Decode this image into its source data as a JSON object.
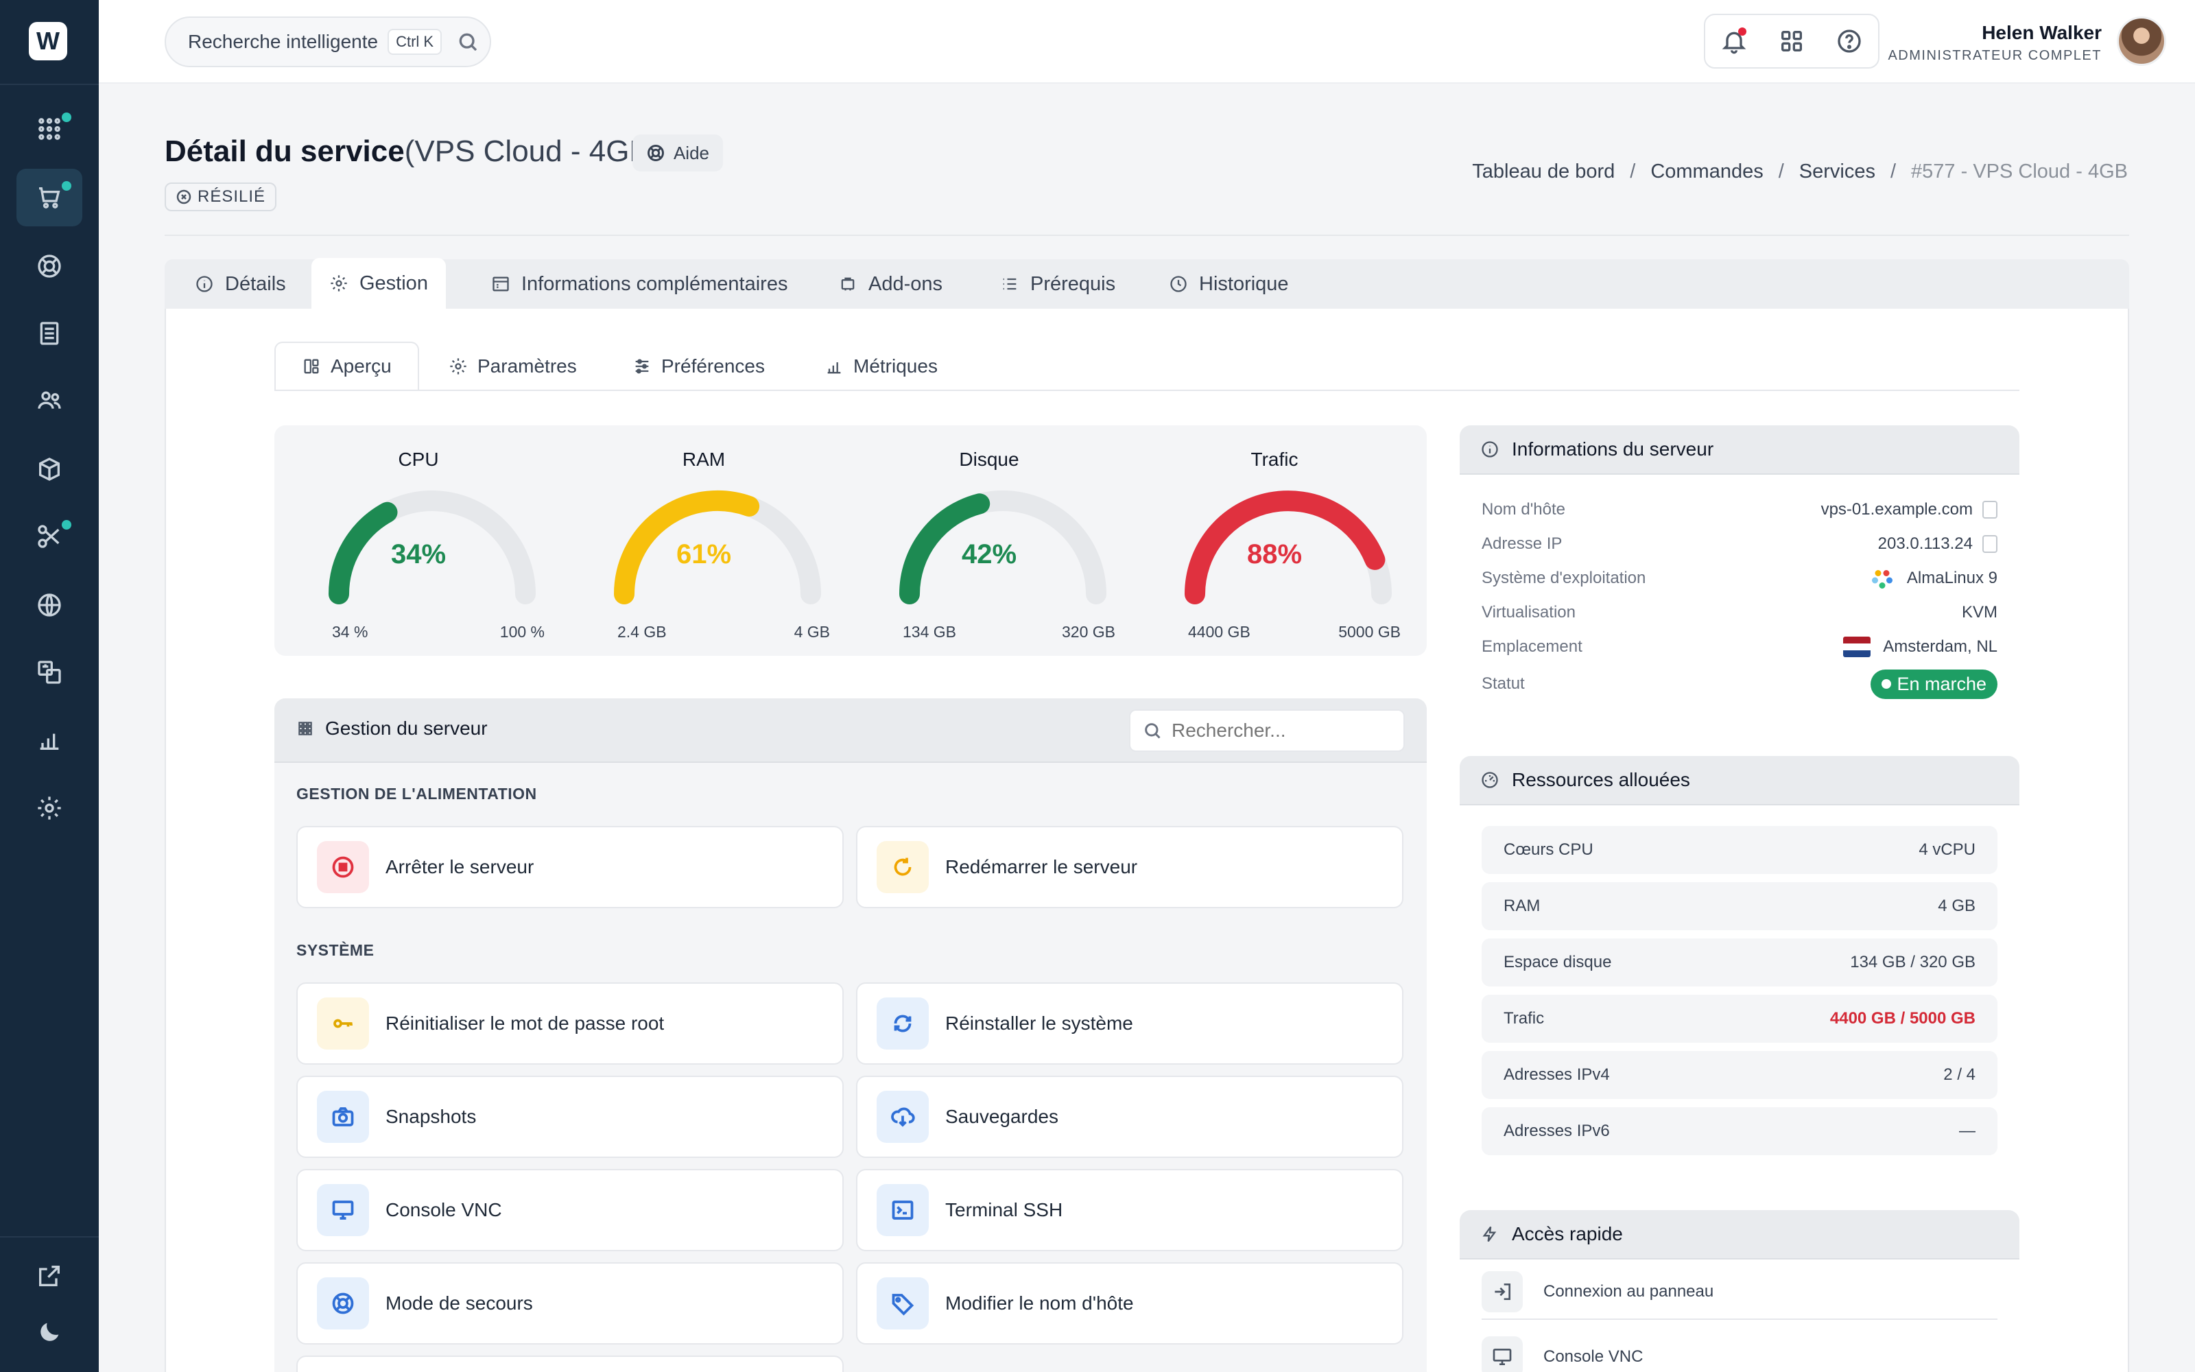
{
  "app": {
    "logo_letter": "W"
  },
  "header": {
    "search_placeholder": "Recherche intelligente",
    "search_shortcut": "Ctrl K",
    "user_name": "Helen Walker",
    "user_role": "ADMINISTRATEUR COMPLET"
  },
  "page": {
    "title_bold": "Détail du service",
    "title_rest": "(VPS Cloud - 4GB)",
    "help_label": "Aide",
    "status_label": "RÉSILIÉ",
    "breadcrumb": [
      "Tableau de bord",
      "Commandes",
      "Services",
      "#577 - VPS Cloud - 4GB"
    ]
  },
  "tabs": [
    "Détails",
    "Gestion",
    "Informations complémentaires",
    "Add-ons",
    "Prérequis",
    "Historique"
  ],
  "subtabs": [
    "Aperçu",
    "Paramètres",
    "Préférences",
    "Métriques"
  ],
  "gauges": [
    {
      "label": "CPU",
      "percent": 34,
      "display": "34%",
      "min": "34 %",
      "max": "100 %",
      "color": "#1d8a52"
    },
    {
      "label": "RAM",
      "percent": 61,
      "display": "61%",
      "min": "2.4 GB",
      "max": "4 GB",
      "color": "#f7c00c"
    },
    {
      "label": "Disque",
      "percent": 42,
      "display": "42%",
      "min": "134 GB",
      "max": "320 GB",
      "color": "#1d8a52"
    },
    {
      "label": "Trafic",
      "percent": 88,
      "display": "88%",
      "min": "4400 GB",
      "max": "5000 GB",
      "color": "#e0313f"
    }
  ],
  "management": {
    "title": "Gestion du serveur",
    "search_placeholder": "Rechercher...",
    "section_power": "GESTION DE L'ALIMENTATION",
    "section_system": "SYSTÈME",
    "actions": {
      "stop": "Arrêter le serveur",
      "restart": "Redémarrer le serveur",
      "reset_pw": "Réinitialiser le mot de passe root",
      "reinstall": "Réinstaller le système",
      "snapshots": "Snapshots",
      "backups": "Sauvegardes",
      "vnc": "Console VNC",
      "ssh": "Terminal SSH",
      "rescue": "Mode de secours",
      "hostname": "Modifier le nom d'hôte"
    }
  },
  "server_info": {
    "title": "Informations du serveur",
    "rows": [
      {
        "k": "Nom d'hôte",
        "v": "vps-01.example.com"
      },
      {
        "k": "Adresse IP",
        "v": "203.0.113.24"
      },
      {
        "k": "Système d'exploitation",
        "v": "AlmaLinux 9"
      },
      {
        "k": "Virtualisation",
        "v": "KVM"
      },
      {
        "k": "Emplacement",
        "v": "Amsterdam, NL"
      },
      {
        "k": "Statut",
        "v": "En marche"
      }
    ]
  },
  "resources": {
    "title": "Ressources allouées",
    "rows": [
      {
        "k": "Cœurs CPU",
        "v": "4 vCPU"
      },
      {
        "k": "RAM",
        "v": "4 GB"
      },
      {
        "k": "Espace disque",
        "v": "134 GB / 320 GB"
      },
      {
        "k": "Trafic",
        "v": "4400 GB / 5000 GB"
      },
      {
        "k": "Adresses IPv4",
        "v": "2 / 4"
      },
      {
        "k": "Adresses IPv6",
        "v": "—"
      }
    ]
  },
  "quick_access": {
    "title": "Accès rapide",
    "items": [
      "Connexion au panneau",
      "Console VNC"
    ]
  },
  "colors": {
    "sidebar": "#16293d",
    "accent_teal": "#2ec4b6",
    "danger": "#e0313f",
    "success": "#1e9e64"
  }
}
